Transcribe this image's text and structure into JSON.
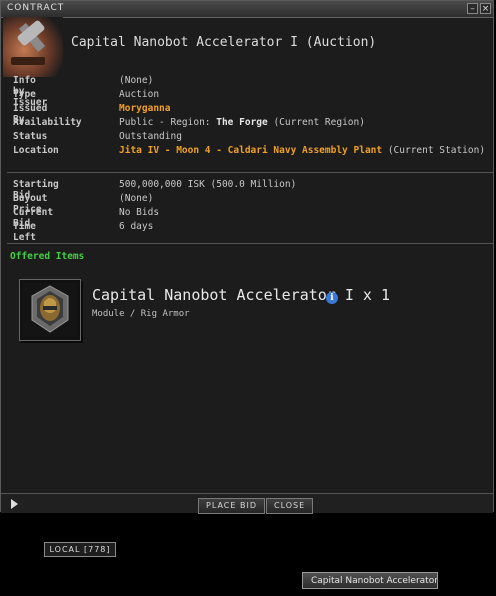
{
  "window": {
    "title": "CONTRACT",
    "minimize_label": "–",
    "close_label": "×"
  },
  "header": {
    "title": "Capital Nanobot Accelerator I (Auction)"
  },
  "details": [
    {
      "key": "Info by Issuer",
      "value": "(None)"
    },
    {
      "key": "Type",
      "value": "Auction"
    },
    {
      "key": "Issued By",
      "value": "Moryganna"
    },
    {
      "key": "Availability",
      "prefix": "Public - Region: ",
      "region": "The Forge",
      "suffix": " (Current Region)"
    },
    {
      "key": "Status",
      "value": "Outstanding"
    },
    {
      "key": "Location",
      "link": "Jita IV - Moon 4 - Caldari Navy Assembly Plant",
      "suffix": " (Current Station)"
    }
  ],
  "bids": [
    {
      "key": "Starting Bid",
      "value": "500,000,000 ISK (500.0 Million)"
    },
    {
      "key": "Buyout Price",
      "value": "(None)"
    },
    {
      "key": "Current Bid",
      "value": "No Bids"
    },
    {
      "key": "Time Left",
      "value": "6 days"
    }
  ],
  "offered": {
    "label": "Offered Items",
    "item_name": "Capital Nanobot Accelerator I x 1",
    "item_category": "Module / Rig Armor",
    "info_glyph": "i"
  },
  "buttons": {
    "place_bid": "PLACE BID",
    "close": "CLOSE"
  },
  "taskbar": {
    "local_chat": "LOCAL [778]",
    "window_tab": "Capital Nanobot Accelerator I"
  },
  "colors": {
    "accent_orange": "#f0a020",
    "section_green": "#42d042",
    "info_blue": "#3a78d8"
  }
}
